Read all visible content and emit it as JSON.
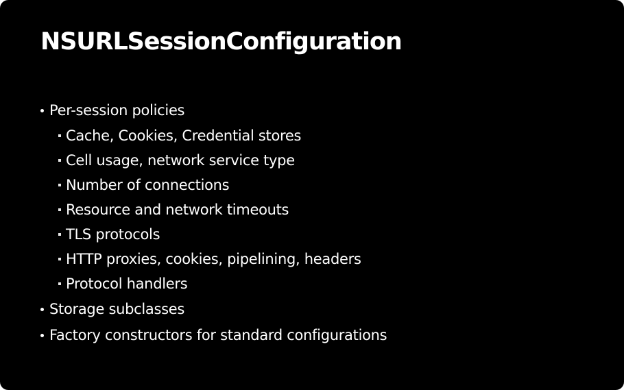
{
  "slide": {
    "title": "NSURLSessionConfiguration",
    "bullets": [
      {
        "text": "Per-session policies",
        "sub": [
          "Cache, Cookies, Credential stores",
          "Cell usage, network service type",
          "Number of connections",
          "Resource and network timeouts",
          "TLS protocols",
          "HTTP proxies, cookies, pipelining, headers",
          "Protocol handlers"
        ]
      },
      {
        "text": "Storage subclasses",
        "sub": []
      },
      {
        "text": "Factory constructors for standard configurations",
        "sub": []
      }
    ]
  },
  "colors": {
    "background": "#000000",
    "text": "#ffffff"
  }
}
